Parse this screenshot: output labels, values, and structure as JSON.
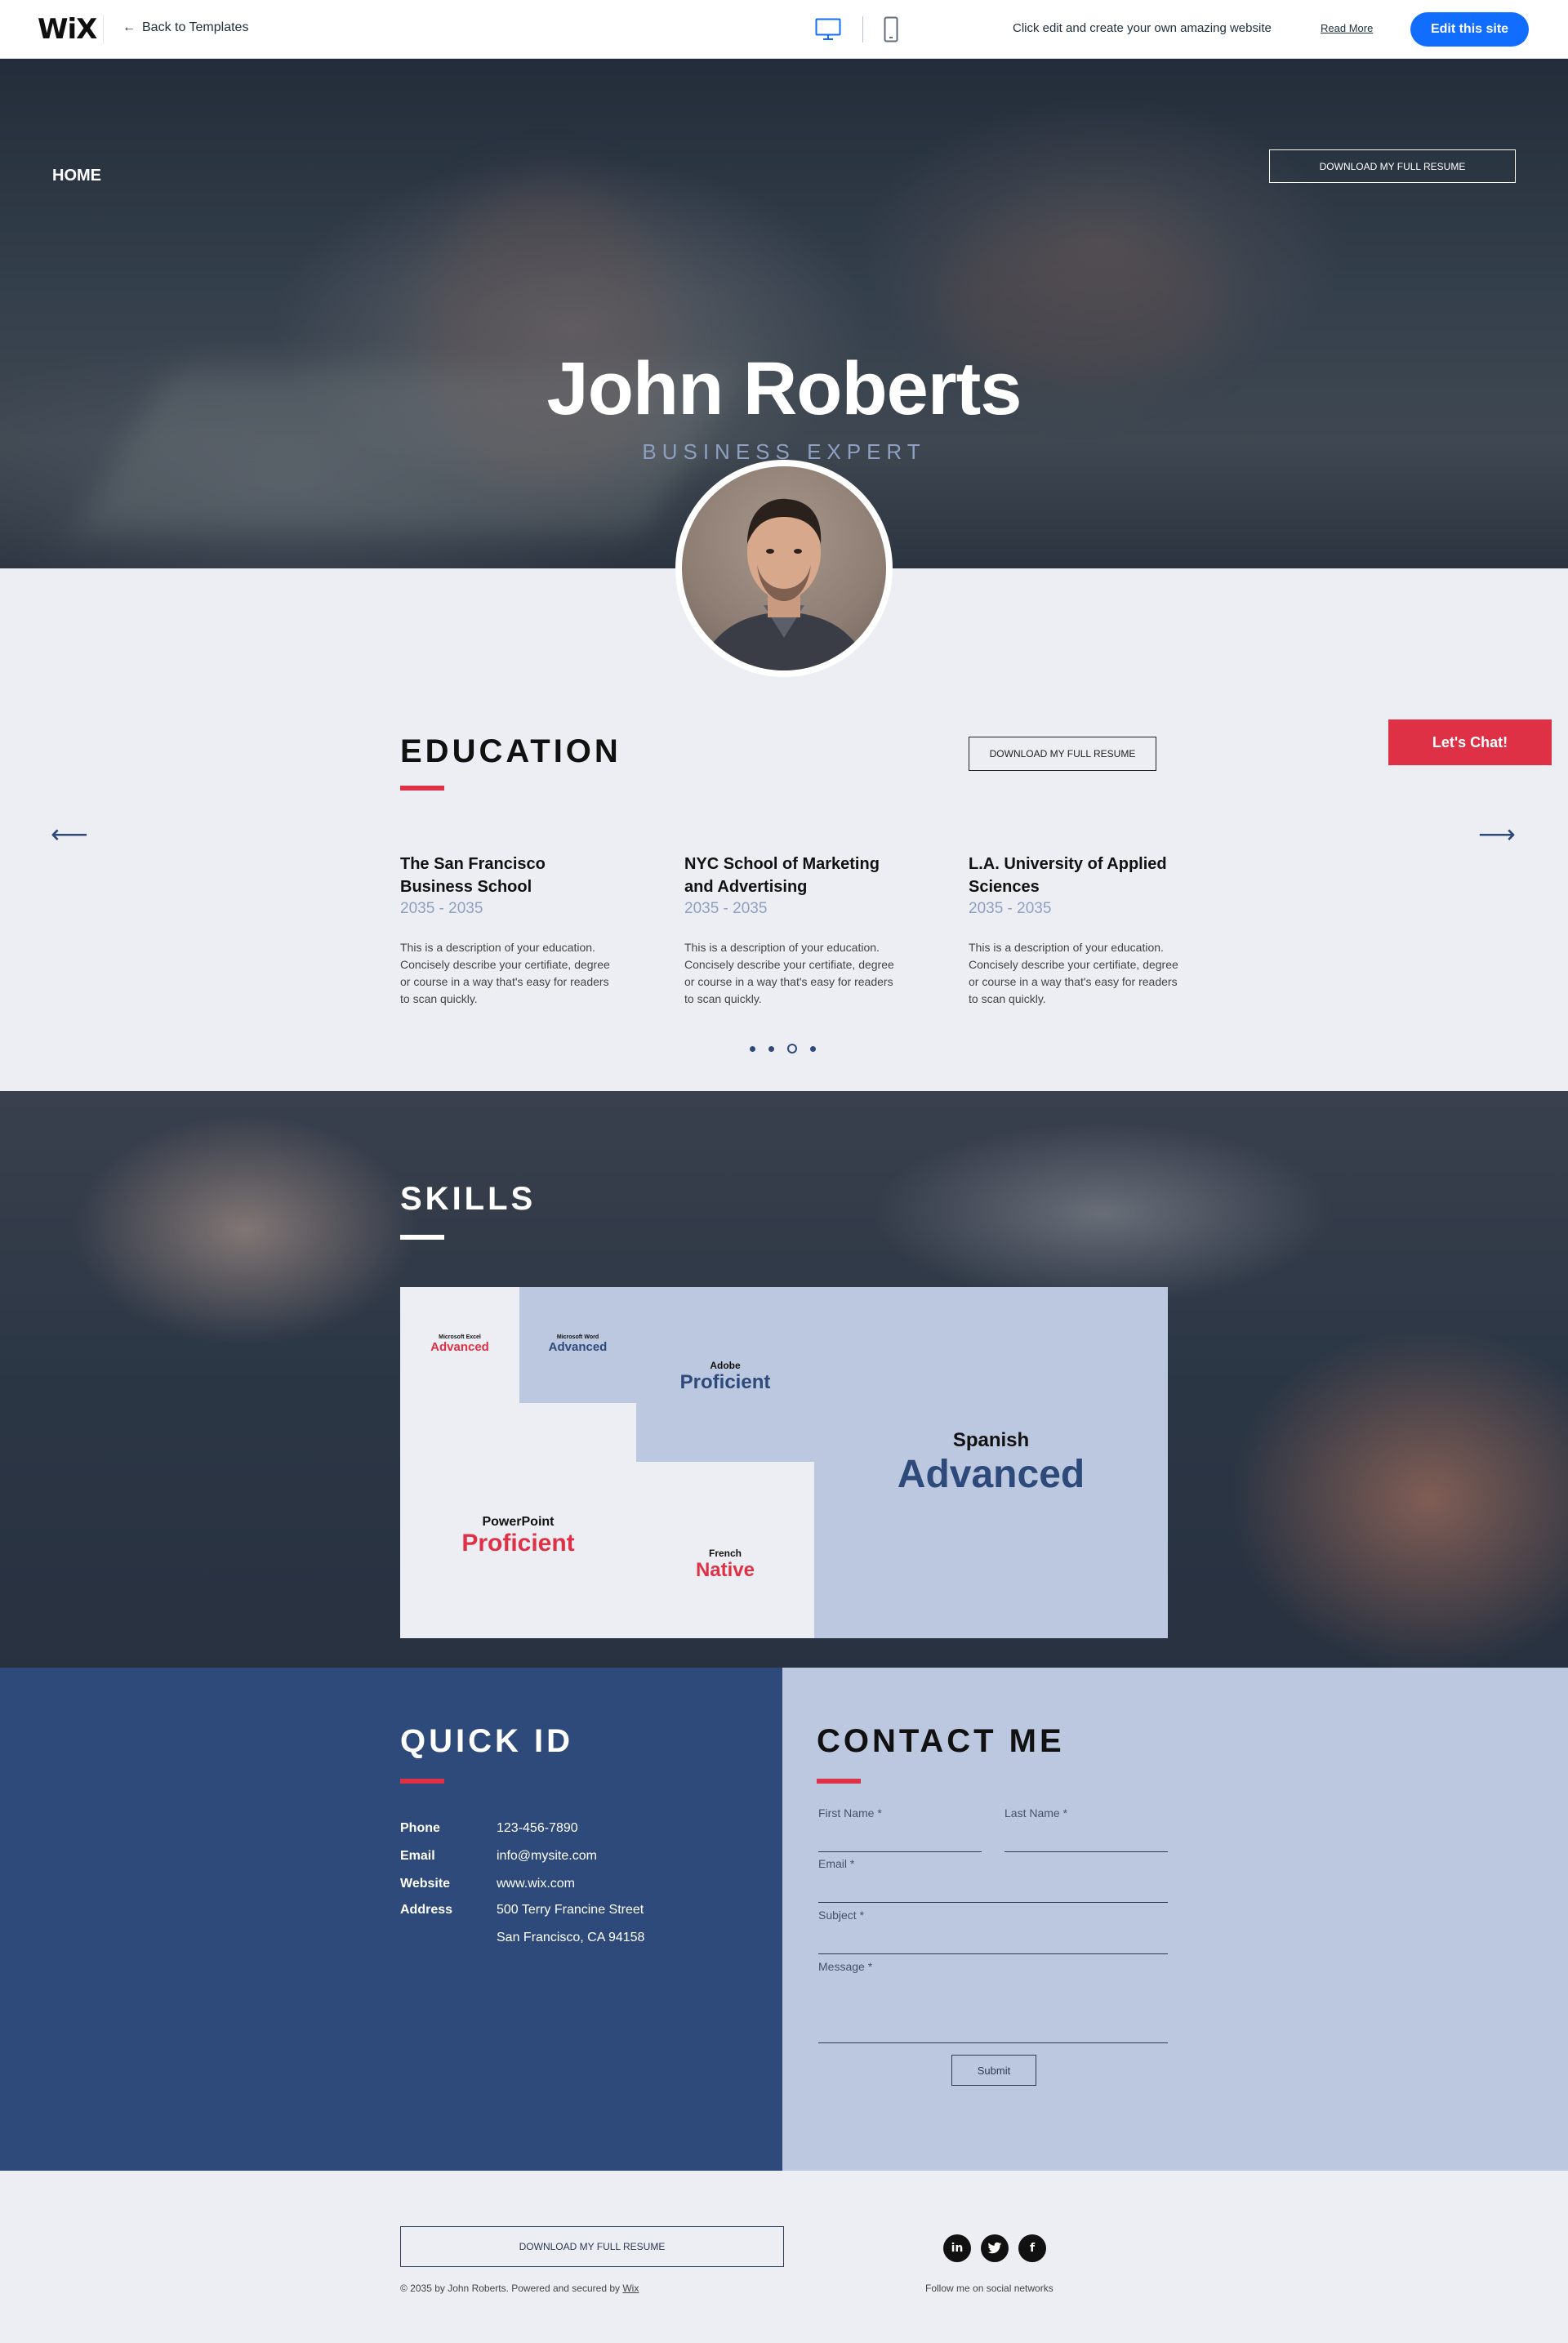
{
  "wix_bar": {
    "logo": "WiX",
    "back_label": "Back to Templates",
    "message": "Click edit and create your own amazing website",
    "read_more": "Read More",
    "edit_label": "Edit this site"
  },
  "hero": {
    "nav_home": "HOME",
    "download_label": "DOWNLOAD MY FULL RESUME",
    "name": "John Roberts",
    "role": "BUSINESS EXPERT"
  },
  "education": {
    "title": "EDUCATION",
    "download_label": "DOWNLOAD MY FULL RESUME",
    "chat_label": "Let's Chat!",
    "items": [
      {
        "school_line1": "The San Francisco",
        "school_line2": "Business School",
        "years": "2035 - 2035",
        "desc": "This is a description of your education. Concisely describe your certifiate, degree or course in a way that's easy for readers to scan quickly."
      },
      {
        "school_line1": "NYC School of Marketing",
        "school_line2": "and Advertising",
        "years": "2035 - 2035",
        "desc": "This is a description of your education. Concisely describe your certifiate, degree or course in a way that's easy for readers to scan quickly."
      },
      {
        "school_line1": "L.A. University of Applied",
        "school_line2": "Sciences",
        "years": "2035 - 2035",
        "desc": "This is a description of your education. Concisely describe your certifiate, degree or course in a way that's easy for readers to scan quickly."
      }
    ]
  },
  "skills": {
    "title": "SKILLS",
    "items": [
      {
        "name": "Microsoft Excel",
        "level": "Advanced"
      },
      {
        "name": "Microsoft Word",
        "level": "Advanced"
      },
      {
        "name": "Adobe",
        "level": "Proficient"
      },
      {
        "name": "Spanish",
        "level": "Advanced"
      },
      {
        "name": "PowerPoint",
        "level": "Proficient"
      },
      {
        "name": "French",
        "level": "Native"
      }
    ]
  },
  "quick_id": {
    "title": "QUICK ID",
    "rows": [
      {
        "key": "Phone",
        "value": "123-456-7890"
      },
      {
        "key": "Email",
        "value": "info@mysite.com"
      },
      {
        "key": "Website",
        "value": "www.wix.com"
      },
      {
        "key": "Address",
        "value": "500 Terry Francine Street"
      },
      {
        "key": "",
        "value": "San Francisco, CA 94158"
      }
    ]
  },
  "contact": {
    "title": "CONTACT ME",
    "first_name": "First Name *",
    "last_name": "Last Name *",
    "email": "Email *",
    "subject": "Subject *",
    "message": "Message *",
    "submit": "Submit"
  },
  "footer": {
    "download_label": "DOWNLOAD MY FULL RESUME",
    "copyright": "© 2035 by John Roberts. Powered and secured by",
    "copyright_link": "Wix",
    "follow": "Follow me on social networks",
    "social_icons": [
      "linkedin-icon",
      "twitter-icon",
      "facebook-icon"
    ]
  },
  "colors": {
    "accent_red": "#de3146",
    "navy": "#2e4a7a",
    "light_blue": "#bcc8df",
    "wix_blue": "#116dff"
  }
}
